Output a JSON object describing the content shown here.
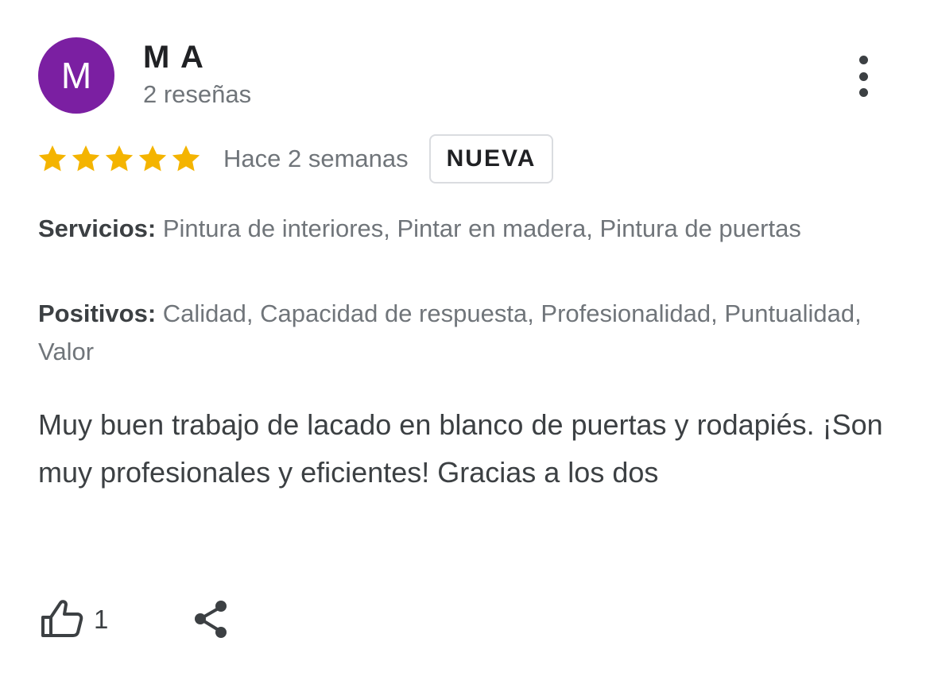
{
  "review": {
    "avatar_letter": "M",
    "avatar_color": "#7b1fa2",
    "author_name": "M A",
    "review_count": "2 reseñas",
    "more_icon": "more-vertical-icon",
    "rating": 5,
    "rating_max": 5,
    "star_color": "#f4b400",
    "time_ago": "Hace 2 semanas",
    "badge": "NUEVA",
    "services_label": "Servicios:",
    "services_value": "Pintura de interiores, Pintar en madera, Pintura de puertas",
    "positives_label": "Positivos:",
    "positives_value": "Calidad, Capacidad de respuesta, Profesionalidad, Puntualidad, Valor",
    "text": "Muy buen trabajo de lacado en blanco de puertas y rodapiés. ¡Son muy profesionales y eficientes! Gracias a los dos",
    "likes": "1",
    "like_icon": "thumbs-up-icon",
    "share_icon": "share-icon"
  }
}
